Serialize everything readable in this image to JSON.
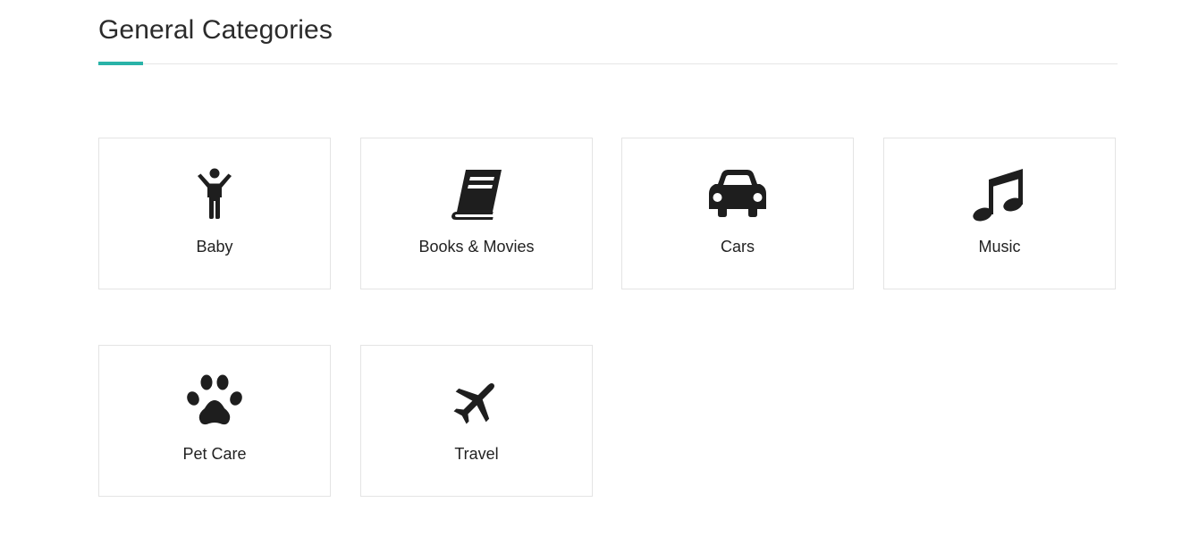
{
  "page": {
    "title": "General Categories",
    "accent_color": "#2ab3a8"
  },
  "categories": [
    {
      "label": "Baby",
      "icon": "child-icon"
    },
    {
      "label": "Books & Movies",
      "icon": "book-icon"
    },
    {
      "label": "Cars",
      "icon": "car-icon"
    },
    {
      "label": "Music",
      "icon": "music-note-icon"
    },
    {
      "label": "Pet Care",
      "icon": "paw-icon"
    },
    {
      "label": "Travel",
      "icon": "plane-icon"
    }
  ]
}
